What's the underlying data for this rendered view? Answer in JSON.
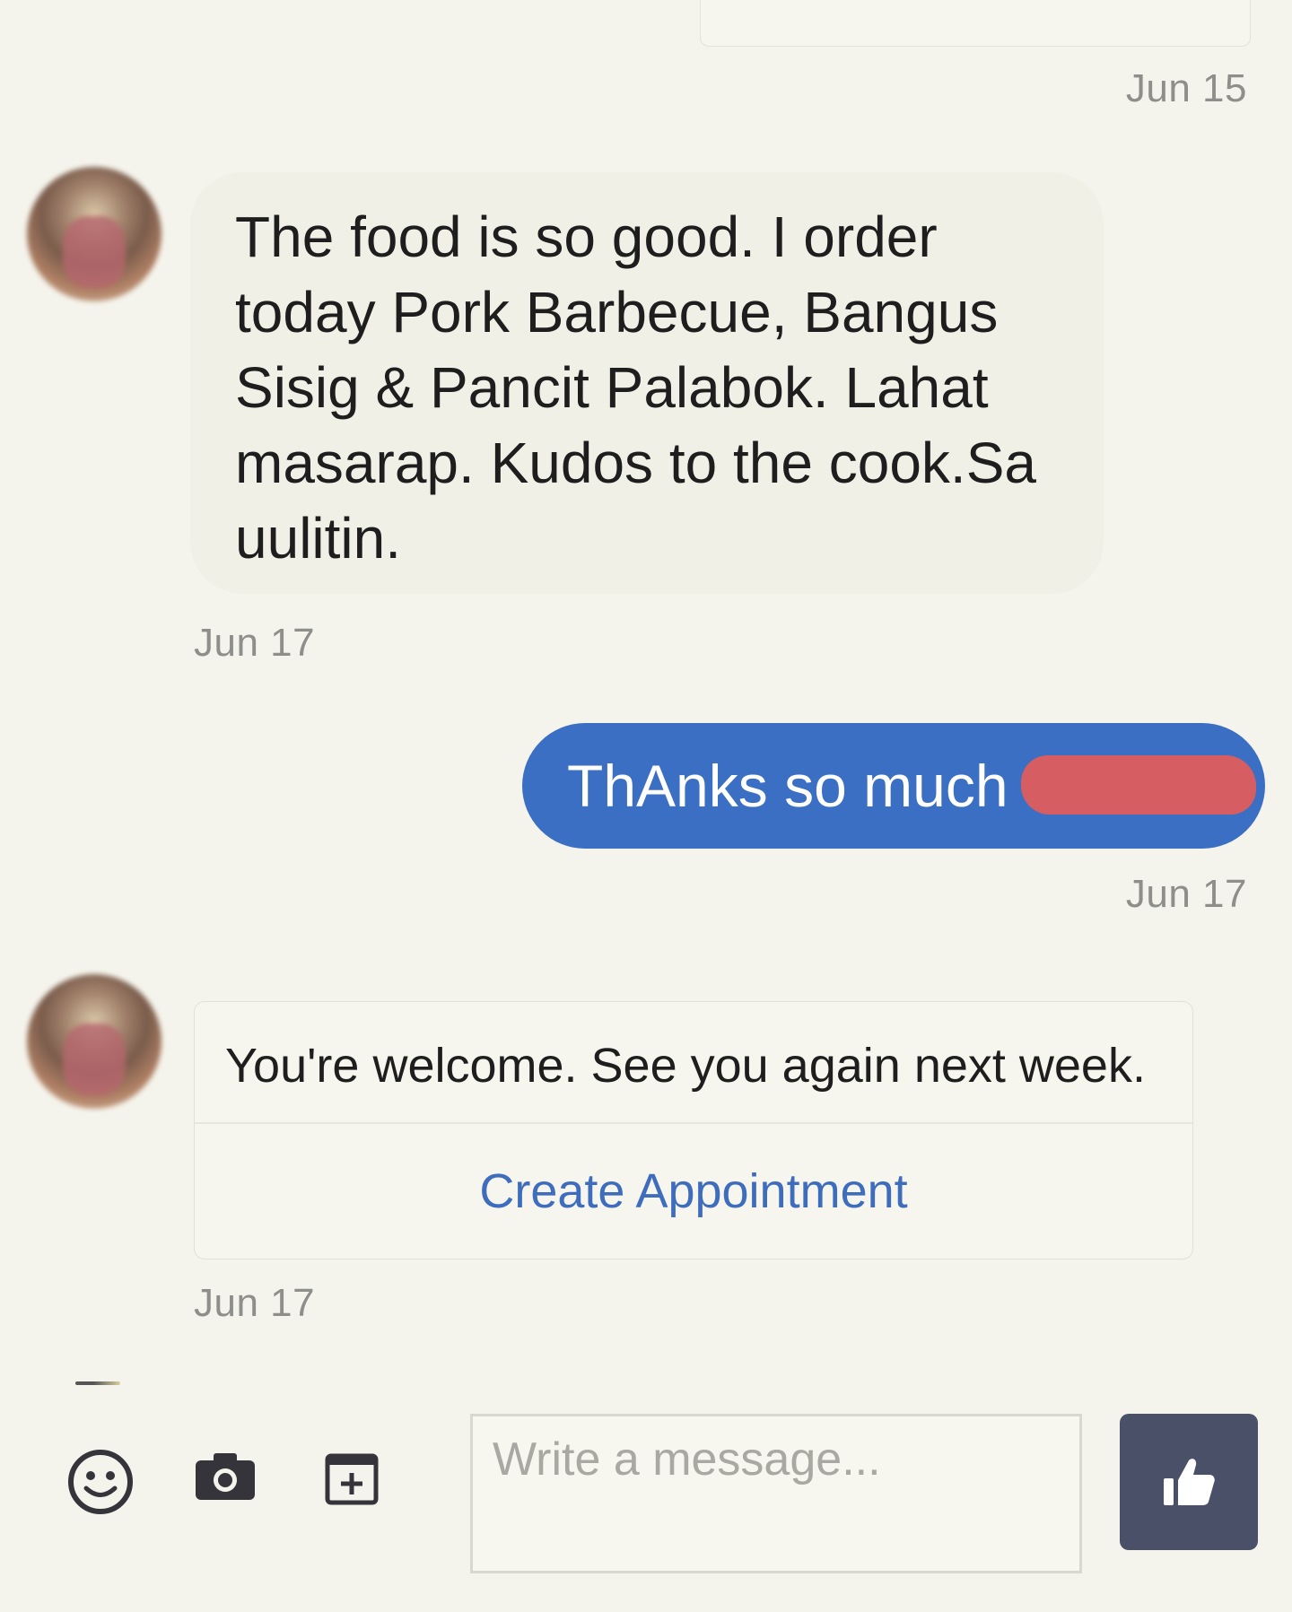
{
  "thread": {
    "previous_timestamp": "Jun 15",
    "messages": [
      {
        "from": "customer",
        "text": "The food is so good. I order today Pork Barbecue, Bangus Sisig & Pancit Palabok. Lahat masarap. Kudos to the cook.Sa uulitin.",
        "timestamp": "Jun 17"
      },
      {
        "from": "business",
        "text": "ThAnks so much",
        "timestamp": "Jun 17"
      },
      {
        "from": "customer",
        "text": "You're welcome. See you again next week.",
        "action_label": "Create Appointment",
        "timestamp": "Jun 17"
      }
    ]
  },
  "composer": {
    "placeholder": "Write a message...",
    "value": "",
    "icons": [
      "smiley-icon",
      "camera-icon",
      "calendar-add-icon",
      "thumbs-up-icon"
    ]
  },
  "colors": {
    "background": "#f5f4ec",
    "outgoing_bubble": "#3a6fc4",
    "incoming_bubble": "#f1f0e6",
    "link": "#3e6dbd",
    "like_button": "#4a5068",
    "redaction": "#d65e62"
  }
}
